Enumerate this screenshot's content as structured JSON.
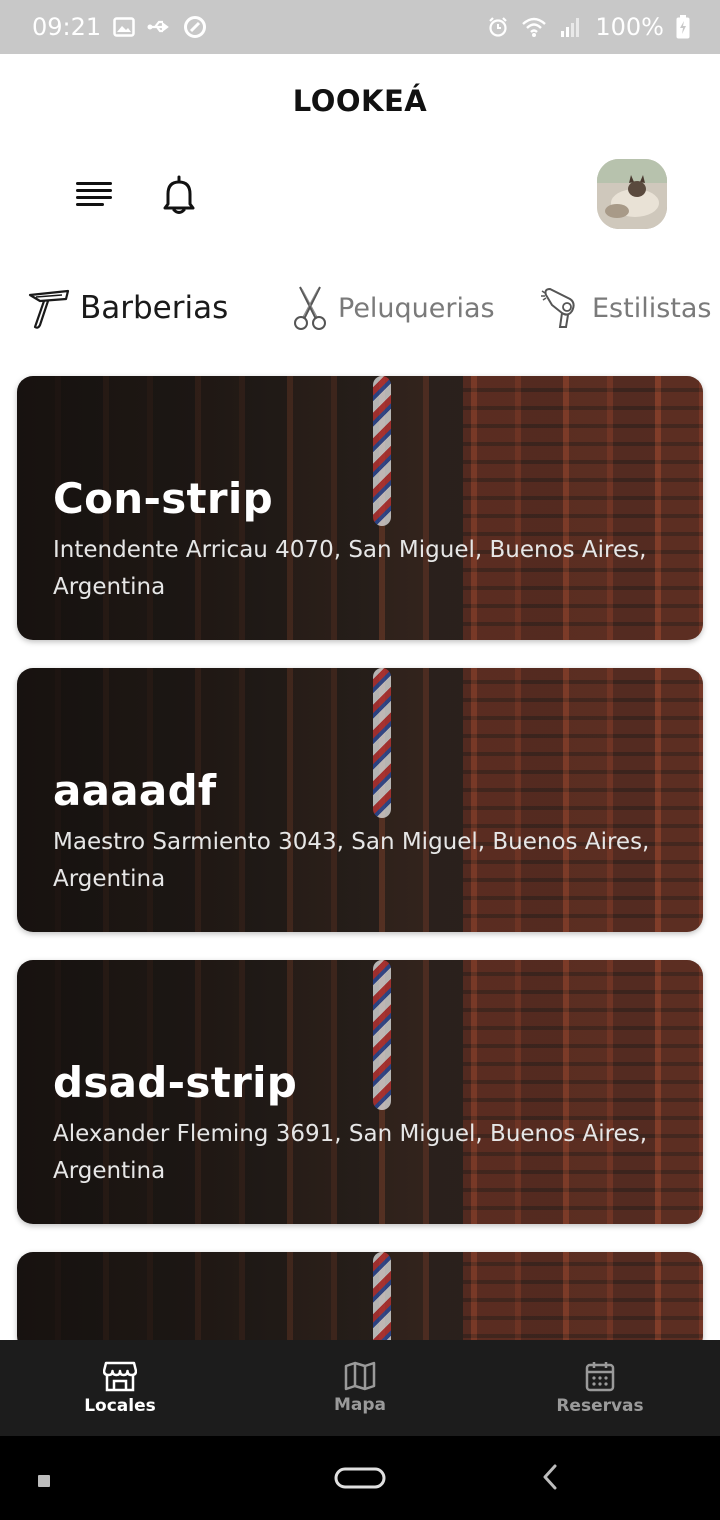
{
  "status_bar": {
    "time": "09:21",
    "battery": "100%"
  },
  "header": {
    "title": "LOOKEÁ"
  },
  "tabs": [
    {
      "label": "Barberias",
      "icon": "razor-icon",
      "active": true
    },
    {
      "label": "Peluquerias",
      "icon": "scissors-icon",
      "active": false
    },
    {
      "label": "Estilistas",
      "icon": "hair-dryer-icon",
      "active": false
    }
  ],
  "cards": [
    {
      "name": "Con-strip",
      "address": "Intendente Arricau 4070, San Miguel, Buenos Aires, Argentina"
    },
    {
      "name": "aaaadf",
      "address": "Maestro Sarmiento 3043, San Miguel, Buenos Aires, Argentina"
    },
    {
      "name": "dsad-strip",
      "address": "Alexander Fleming 3691, San Miguel, Buenos Aires, Argentina"
    }
  ],
  "bottom_nav": [
    {
      "label": "Locales",
      "icon": "store-icon",
      "active": true
    },
    {
      "label": "Mapa",
      "icon": "map-icon",
      "active": false
    },
    {
      "label": "Reservas",
      "icon": "calendar-icon",
      "active": false
    }
  ],
  "colors": {
    "nav_background": "#1c1c1c",
    "active_text": "#ffffff",
    "inactive_text": "#9a9a9a"
  }
}
